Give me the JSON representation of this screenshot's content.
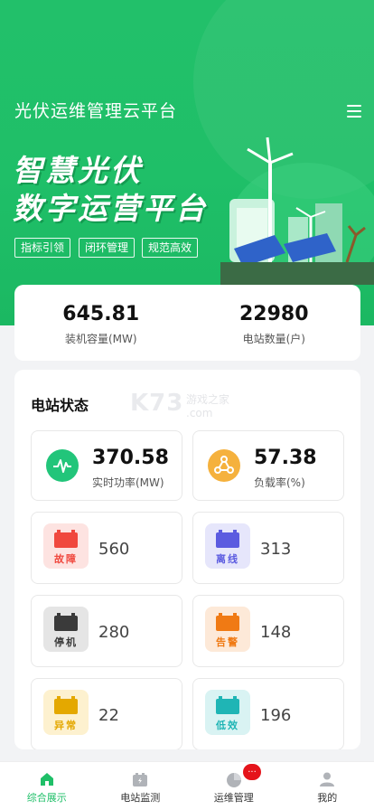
{
  "app_title": "光伏运维管理云平台",
  "slogan": {
    "line1": "智慧光伏",
    "line2": "数字运营平台"
  },
  "tags": [
    "指标引领",
    "闭环管理",
    "规范高效"
  ],
  "summary": {
    "capacity": {
      "value": "645.81",
      "label": "装机容量(MW)"
    },
    "stations": {
      "value": "22980",
      "label": "电站数量(户)"
    }
  },
  "status": {
    "title": "电站状态",
    "watermark": "K73",
    "watermark_sub": "游戏之家",
    "watermark_sub2": ".com",
    "power": {
      "value": "370.58",
      "label": "实时功率(MW)",
      "icon": "waveform-icon",
      "color": "#22c57a"
    },
    "load": {
      "value": "57.38",
      "label": "负载率(%)",
      "icon": "share-nodes-icon",
      "color": "#f5b13d"
    },
    "states": [
      {
        "label": "故障",
        "count": "560",
        "bg": "#fde3e1",
        "fg": "#f0483e"
      },
      {
        "label": "离线",
        "count": "313",
        "bg": "#e6e6fb",
        "fg": "#5b5be0"
      },
      {
        "label": "停机",
        "count": "280",
        "bg": "#e5e5e5",
        "fg": "#3a3a3a"
      },
      {
        "label": "告警",
        "count": "148",
        "bg": "#fde9d8",
        "fg": "#f07a14"
      },
      {
        "label": "异常",
        "count": "22",
        "bg": "#fdf1cf",
        "fg": "#e4a800"
      },
      {
        "label": "低效",
        "count": "196",
        "bg": "#d9f3f3",
        "fg": "#1fb5b5"
      }
    ]
  },
  "tabbar": {
    "items": [
      {
        "label": "综合展示",
        "icon": "home-icon"
      },
      {
        "label": "电站监测",
        "icon": "battery-monitor-icon"
      },
      {
        "label": "运维管理",
        "icon": "pie-icon"
      },
      {
        "label": "我的",
        "icon": "user-icon"
      }
    ],
    "badge": "..."
  },
  "colors": {
    "brand": "#1fbf68"
  }
}
